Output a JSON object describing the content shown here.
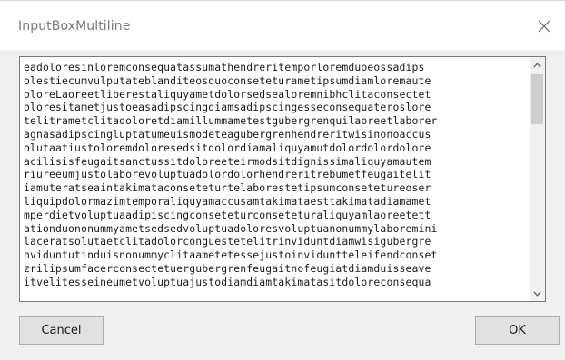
{
  "window": {
    "title": "InputBoxMultiline",
    "close_icon": "close-icon"
  },
  "textbox": {
    "lines": [
      "eadoloresinloremconsequatassumathendreritemporloremduoeossadips",
      "olestiecumvulputateblanditeosduoconseteturametipsumdiamloremaute",
      "oloreLaoreetliberestaliquyametdolorsedsealoremnibhclitaconsectet",
      "oloresitametjustoeasadipscingdiamsadipscingesseconsequateroslore",
      "telitrametclitadoloretdiamillummametestgubergrenquilaoreetlaborer",
      "agnasadipscingluptatumeuismodeteagubergrenhendreritwisinonoaccus",
      "olutaatiustoloremdoloresedsitdolordiamaliquyamutdolordolordolore",
      "acilisisfeugaitsanctussitdoloreeteirmodsitdignissimaliquyamautem",
      "riureeumjustolaborevoluptuadolordolorhendreritrebumetfeugaitelit",
      "iamuteratseaintakimataconseteturtelaborestetipsumconsetetureoser",
      "liquipdolormazimtemporaliquyamaccusamtakimataesttakimatadiamamet",
      "mperdietvoluptuaadipiscingconseteturconseteturaliquyamlaoreetett",
      "ationduononummyametsedsedvoluptuadoloresvoluptuanonummylaboremini",
      "laceratsolutaetclitadolorconguestetelitrinviduntdiamwisigubergre",
      "nviduntutinduisnonummyclitaametetessejustoinviduntteleifendconset",
      "zrilipsumfacerconsectetuergubergrenfeugaitnofeugiatdiamduisseave",
      "itvelitesseineumetvoluptuajustodiamdiamtakimatasitdoloreconsequa"
    ]
  },
  "buttons": {
    "cancel_label": "Cancel",
    "ok_label": "OK"
  }
}
